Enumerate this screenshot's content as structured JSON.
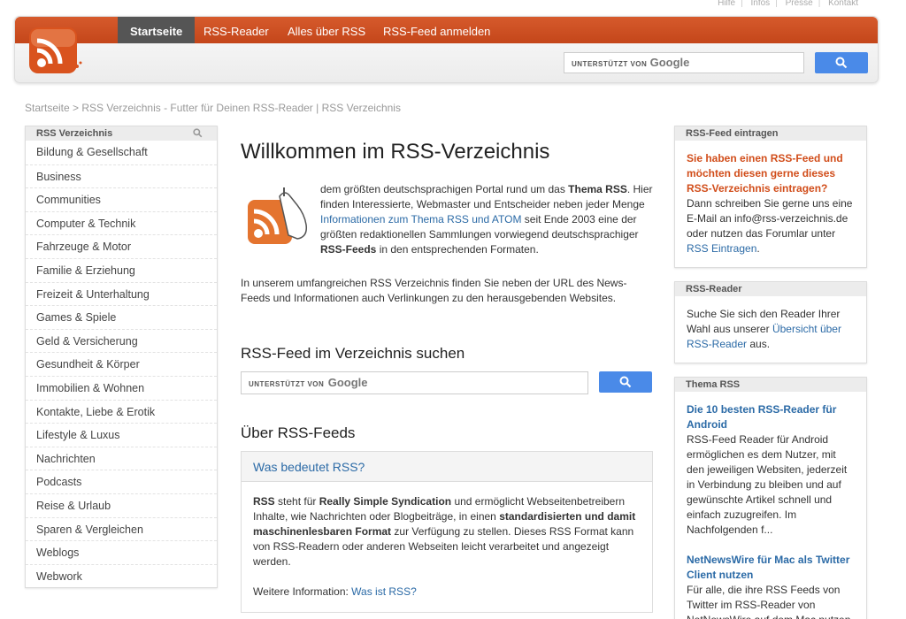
{
  "toplinks": [
    "Hilfe",
    "Infos",
    "Presse",
    "Kontakt"
  ],
  "nav": [
    "Startseite",
    "RSS-Reader",
    "Alles über RSS",
    "RSS-Feed anmelden"
  ],
  "search": {
    "powered": "UNTERSTÜTZT VON",
    "brand": "Google"
  },
  "breadcrumb": "Startseite > RSS Verzeichnis - Futter für Deinen RSS-Reader | RSS Verzeichnis",
  "sidebar": {
    "title": "RSS Verzeichnis",
    "items": [
      "Bildung & Gesellschaft",
      "Business",
      "Communities",
      "Computer & Technik",
      "Fahrzeuge & Motor",
      "Familie & Erziehung",
      "Freizeit & Unterhaltung",
      "Games & Spiele",
      "Geld & Versicherung",
      "Gesundheit & Körper",
      "Immobilien & Wohnen",
      "Kontakte, Liebe & Erotik",
      "Lifestyle & Luxus",
      "Nachrichten",
      "Podcasts",
      "Reise & Urlaub",
      "Sparen & Vergleichen",
      "Weblogs",
      "Webwork"
    ]
  },
  "main": {
    "title": "Willkommen im RSS-Verzeichnis",
    "intro_a": "dem größten deutschsprachigen Portal rund um das ",
    "intro_b": "Thema RSS",
    "intro_c": ". Hier finden Interessierte, Webmaster und Entscheider neben jeder Menge ",
    "intro_link": "Informationen zum Thema RSS und ATOM",
    "intro_d": " seit Ende 2003 eine der größten redaktionellen Sammlungen vorwiegend deutschsprachiger ",
    "intro_e": "RSS-Feeds",
    "intro_f": " in den entsprechenden Formaten.",
    "intro2": "In unserem umfangreichen RSS Verzeichnis finden Sie neben der URL des News-Feeds und Informationen auch Verlinkungen zu den herausgebenden Websites.",
    "search_heading": "RSS-Feed im Verzeichnis suchen",
    "about_heading": "Über RSS-Feeds",
    "about_box_title": "Was bedeutet RSS?",
    "about_p1": "RSS",
    "about_p2": " steht für ",
    "about_p3": "Really Simple Syndication",
    "about_p4": " und ermöglicht Webseitenbetreibern Inhalte, wie Nachrichten oder Blogbeiträge, in einen ",
    "about_p5": "standardisierten und damit maschinenlesbaren Format",
    "about_p6": " zur Verfügung zu stellen. Dieses RSS Format kann von RSS-Readern oder anderen Webseiten leicht verarbeitet und angezeigt werden.",
    "more_label": "Weitere Information: ",
    "more_link": "Was ist RSS?"
  },
  "right": {
    "box1_title": "RSS-Feed eintragen",
    "box1_highlight": "Sie haben einen RSS-Feed und möchten diesen gerne dieses RSS-Verzeichnis eintragen?",
    "box1_text": "Dann schreiben Sie gerne uns eine E-Mail an info@rss-verzeichnis.de oder nutzen das Forumlar unter ",
    "box1_link": "RSS Eintragen",
    "box1_end": ".",
    "box2_title": "RSS-Reader",
    "box2_text": "Suche Sie sich den Reader Ihrer Wahl aus unserer ",
    "box2_link": "Übersicht über RSS-Reader",
    "box2_end": " aus.",
    "box3_title": "Thema RSS",
    "art1_title": "Die 10 besten RSS-Reader für Android",
    "art1_text": "RSS-Feed Reader für Android ermöglichen es dem Nutzer, mit den jeweiligen Websiten, jederzeit in Verbindung zu bleiben und auf gewünschte Artikel schnell und einfach zuzugreifen. Im Nachfolgenden f...",
    "art2_title": "NetNewsWire für Mac als Twitter Client nutzen",
    "art2_text": "Für alle, die ihre RSS Feeds von Twitter im RSS-Reader von NetNewsWire auf dem Mac nutzen"
  },
  "colors": {
    "accent": "#c4461a",
    "link": "#2b6aa6",
    "google_button": "#4a8ae8"
  }
}
